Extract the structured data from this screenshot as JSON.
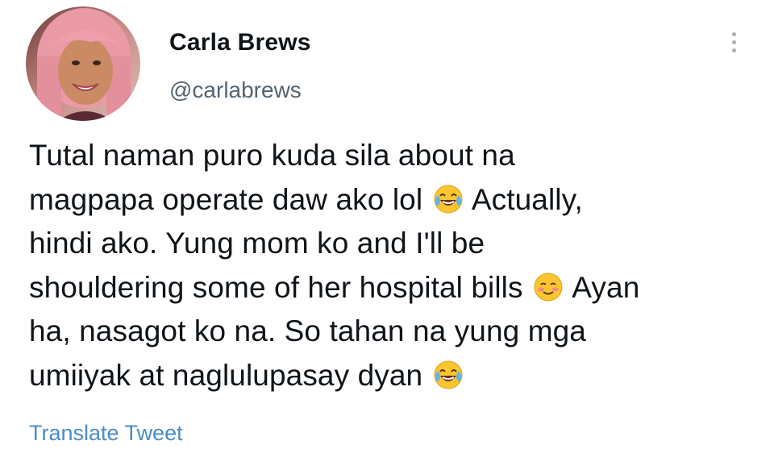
{
  "tweet": {
    "author": {
      "display_name": "Carla Brews",
      "handle": "@carlabrews"
    },
    "body_lines": [
      {
        "text_before": "Tutal naman puro kuda sila about na",
        "emoji": "",
        "text_after": ""
      },
      {
        "text_before": "magpapa operate daw ako lol ",
        "emoji": "face-with-tears-of-joy",
        "text_after": " Actually,"
      },
      {
        "text_before": "hindi ako. Yung mom ko and I'll be",
        "emoji": "",
        "text_after": ""
      },
      {
        "text_before": "shouldering some of her hospital bills ",
        "emoji": "smiling-face",
        "text_after": " Ayan"
      },
      {
        "text_before": "ha, nasagot ko na. So tahan na yung mga",
        "emoji": "",
        "text_after": ""
      },
      {
        "text_before": "umiiyak at naglulupasay dyan ",
        "emoji": "face-with-tears-of-joy",
        "text_after": ""
      }
    ],
    "translate_label": "Translate Tweet",
    "more_icon": "vertical-ellipsis-icon"
  },
  "colors": {
    "text": "#0f1419",
    "secondary_text": "#536471",
    "link": "#4a8cc8",
    "more_dots": "#a7b1ba"
  }
}
